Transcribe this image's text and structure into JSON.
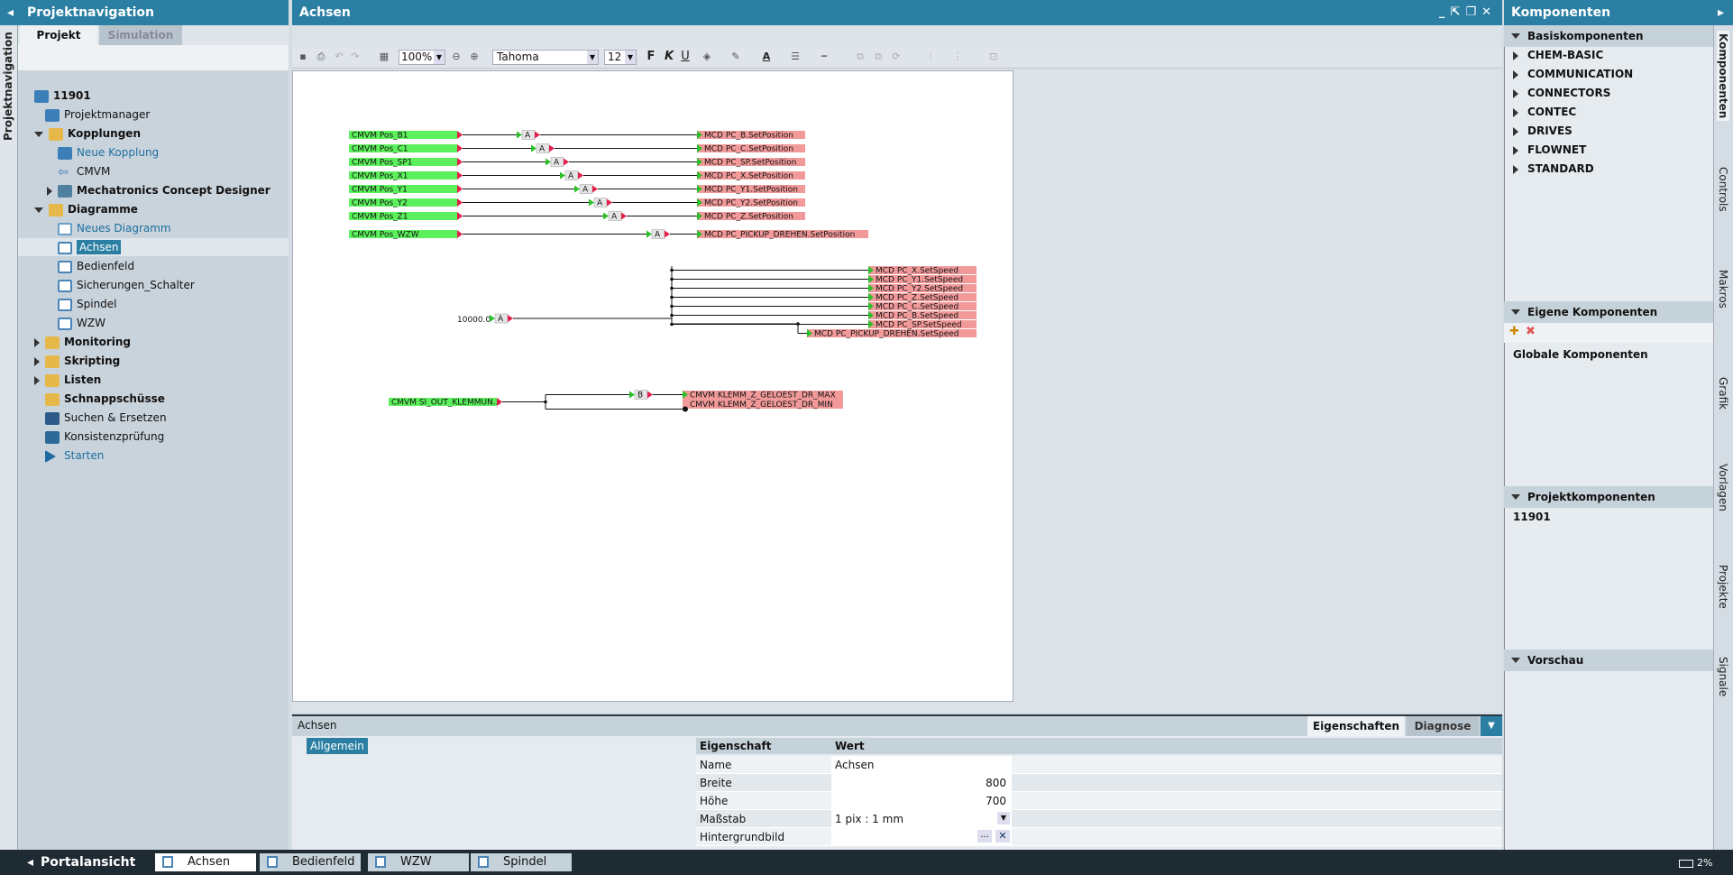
{
  "left_panel": {
    "title": "Projektnavigation",
    "vertical_tab": "Projektnavigation",
    "tabs": [
      {
        "label": "Projekt"
      },
      {
        "label": "Simulation"
      }
    ],
    "tree": [
      {
        "label": "11901",
        "indent": 0,
        "bold": true,
        "icon": "project-cube-icon"
      },
      {
        "label": "Projektmanager",
        "indent": 1,
        "icon": "project-manager-icon"
      },
      {
        "label": "Kopplungen",
        "indent": 1,
        "bold": true,
        "expanded": true,
        "icon": "folder-icon"
      },
      {
        "label": "Neue Kopplung",
        "indent": 2,
        "link": true,
        "icon": "new-coupling-icon"
      },
      {
        "label": "CMVM",
        "indent": 2,
        "icon": "cmvm-arrow-icon"
      },
      {
        "label": "Mechatronics Concept Designer",
        "indent": 2,
        "bold": true,
        "collapsed": true,
        "icon": "mcd-icon"
      },
      {
        "label": "Diagramme",
        "indent": 1,
        "bold": true,
        "expanded": true,
        "icon": "folder-icon"
      },
      {
        "label": "Neues Diagramm",
        "indent": 2,
        "link": true,
        "icon": "new-diagram-icon"
      },
      {
        "label": "Achsen",
        "indent": 2,
        "selected": true,
        "icon": "diagram-icon"
      },
      {
        "label": "Bedienfeld",
        "indent": 2,
        "icon": "diagram-icon"
      },
      {
        "label": "Sicherungen_Schalter",
        "indent": 2,
        "icon": "diagram-icon"
      },
      {
        "label": "Spindel",
        "indent": 2,
        "icon": "diagram-icon"
      },
      {
        "label": "WZW",
        "indent": 2,
        "icon": "diagram-icon"
      },
      {
        "label": "Monitoring",
        "indent": 1,
        "bold": true,
        "collapsed": true,
        "icon": "monitoring-folder-icon"
      },
      {
        "label": "Skripting",
        "indent": 1,
        "bold": true,
        "collapsed": true,
        "icon": "script-folder-icon"
      },
      {
        "label": "Listen",
        "indent": 1,
        "bold": true,
        "collapsed": true,
        "icon": "list-folder-icon"
      },
      {
        "label": "Schnappschüsse",
        "indent": 1,
        "bold": true,
        "icon": "snapshot-folder-icon"
      },
      {
        "label": "Suchen & Ersetzen",
        "indent": 1,
        "icon": "binoculars-icon"
      },
      {
        "label": "Konsistenzprüfung",
        "indent": 1,
        "icon": "consistency-check-icon"
      },
      {
        "label": "Starten",
        "indent": 1,
        "link": true,
        "icon": "play-icon"
      }
    ]
  },
  "editor": {
    "title": "Achsen",
    "toolbar": {
      "zoom": "100%",
      "font": "Tahoma",
      "font_size": "12",
      "bold": "F",
      "italic": "K",
      "underline": "U",
      "text_color": "A"
    },
    "diagram": {
      "group1": [
        {
          "src": "CMVM Pos_B1",
          "dst": "MCD PC_B.SetPosition"
        },
        {
          "src": "CMVM Pos_C1",
          "dst": "MCD PC_C.SetPosition"
        },
        {
          "src": "CMVM Pos_SP1",
          "dst": "MCD PC_SP.SetPosition"
        },
        {
          "src": "CMVM Pos_X1",
          "dst": "MCD PC_X.SetPosition"
        },
        {
          "src": "CMVM Pos_Y1",
          "dst": "MCD PC_Y1.SetPosition"
        },
        {
          "src": "CMVM Pos_Y2",
          "dst": "MCD PC_Y2.SetPosition"
        },
        {
          "src": "CMVM Pos_Z1",
          "dst": "MCD PC_Z.SetPosition"
        },
        {
          "src": "CMVM Pos_WZW",
          "dst": "MCD PC_PICKUP_DREHEN.SetPosition"
        }
      ],
      "group2_source": "10000.0",
      "group2_targets": [
        "MCD PC_X.SetSpeed",
        "MCD PC_Y1.SetSpeed",
        "MCD PC_Y2.SetSpeed",
        "MCD PC_Z.SetSpeed",
        "MCD PC_C.SetSpeed",
        "MCD PC_B.SetSpeed",
        "MCD PC_SP.SetSpeed",
        "MCD PC_PICKUP_DREHEN.SetSpeed"
      ],
      "group3_source": "CMVM SI_OUT_KLEMMUN...",
      "group3_targets": [
        "CMVM KLEMM_Z_GELOEST_DR_MAX",
        "CMVM KLEMM_Z_GELOEST_DR_MIN"
      ],
      "block_a": "A",
      "block_b": "B"
    }
  },
  "properties": {
    "title": "Achsen",
    "tabs": [
      {
        "label": "Eigenschaften"
      },
      {
        "label": "Diagnose"
      }
    ],
    "group_button": "Allgemein",
    "headers": [
      "Eigenschaft",
      "Wert"
    ],
    "rows": [
      {
        "name": "Name",
        "value": "Achsen",
        "align": "left"
      },
      {
        "name": "Breite",
        "value": "800",
        "align": "right"
      },
      {
        "name": "Höhe",
        "value": "700",
        "align": "right"
      },
      {
        "name": "Maßstab",
        "value": "1 pix : 1 mm",
        "align": "left",
        "dropdown": true
      },
      {
        "name": "Hintergrundbild",
        "value": "",
        "align": "left",
        "browse": "..."
      }
    ]
  },
  "right_panel": {
    "title": "Komponenten",
    "basis": {
      "title": "Basiskomponenten",
      "items": [
        "CHEM-BASIC",
        "COMMUNICATION",
        "CONNECTORS",
        "CONTEC",
        "DRIVES",
        "FLOWNET",
        "STANDARD"
      ]
    },
    "eigene": {
      "title": "Eigene Komponenten",
      "items": [
        "Globale Komponenten"
      ]
    },
    "projekt": {
      "title": "Projektkomponenten",
      "items": [
        "11901"
      ]
    },
    "vorschau": {
      "title": "Vorschau"
    },
    "vertical_tabs": [
      "Komponenten",
      "Controls",
      "Makros",
      "Grafik",
      "Vorlagen",
      "Projekte",
      "Signale"
    ]
  },
  "taskbar": {
    "portal": "Portalansicht",
    "tabs": [
      {
        "label": "Achsen",
        "active": true
      },
      {
        "label": "Bedienfeld"
      },
      {
        "label": "WZW"
      },
      {
        "label": "Spindel"
      }
    ],
    "progress": "2%"
  },
  "colors": {
    "accent": "#2b7fa3",
    "src_green": "#5cf05c",
    "dst_red": "#f29a9a"
  }
}
